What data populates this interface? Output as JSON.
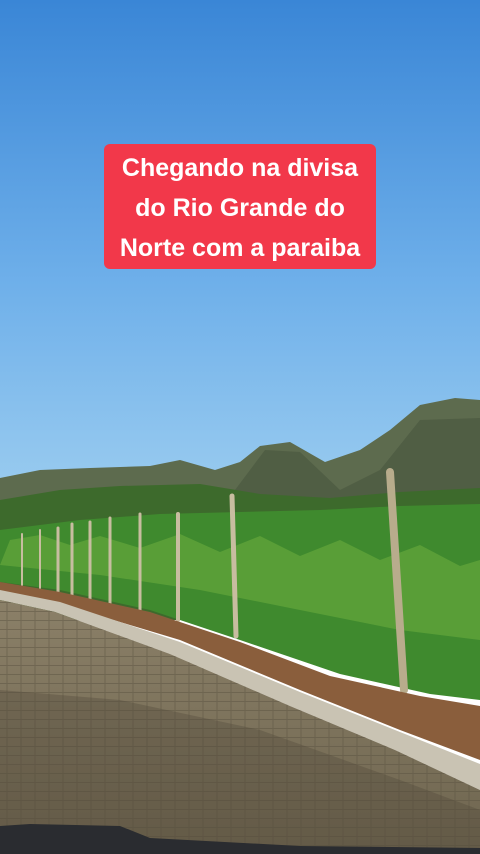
{
  "caption": {
    "lines": [
      "Chegando na divisa",
      "do Rio Grande do",
      "Norte com a paraiba"
    ]
  },
  "colors": {
    "caption_background": "#f2384a",
    "caption_text": "#ffffff",
    "sky_top": "#3a86d6",
    "sky_bottom": "#8ec3ee"
  }
}
